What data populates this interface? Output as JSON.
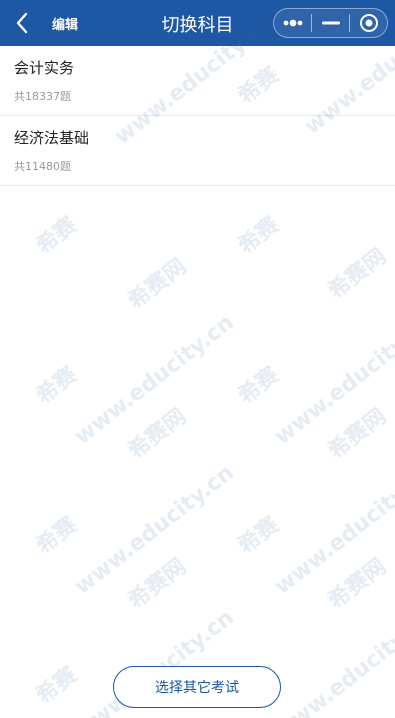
{
  "header": {
    "edit_label": "编辑",
    "title": "切换科目",
    "icons": {
      "back": "back-arrow-icon",
      "more": "more-dots-icon",
      "minimize": "minimize-icon",
      "close": "close-circle-icon"
    }
  },
  "subjects": [
    {
      "name": "会计实务",
      "count": "共18337题"
    },
    {
      "name": "经济法基础",
      "count": "共11480题"
    }
  ],
  "watermark": {
    "brand": "希赛",
    "site": "www.educity.cn",
    "net": "希赛网"
  },
  "bottom_button": {
    "label": "选择其它考试"
  },
  "colors": {
    "brand_blue": "#1e57a3",
    "background": "#ffffff",
    "muted_text": "#999999"
  }
}
